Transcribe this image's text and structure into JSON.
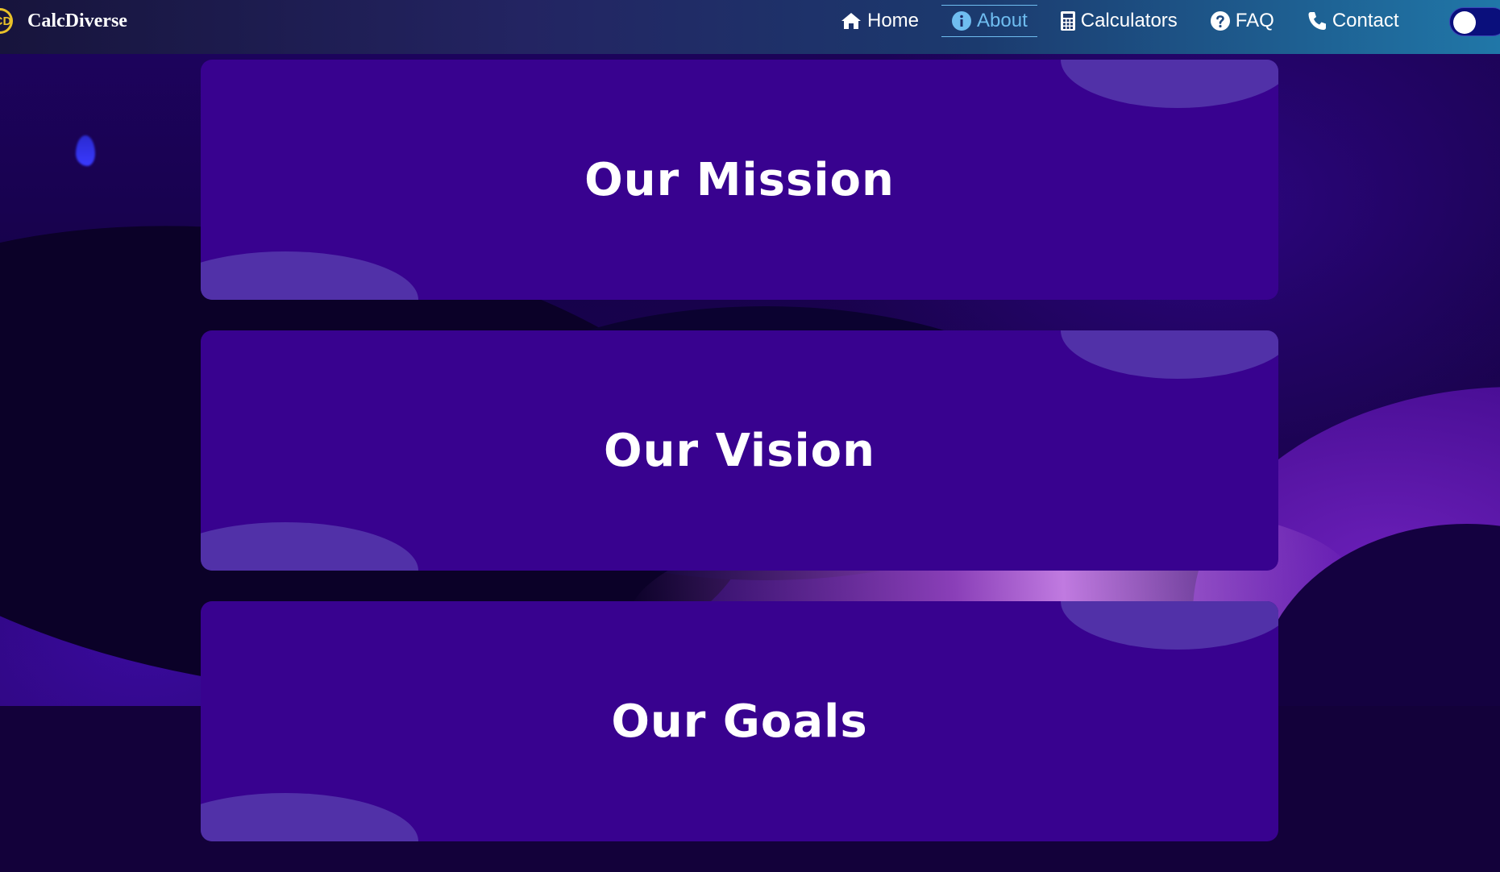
{
  "brand": {
    "logo_text": "CD",
    "name": "CalcDiverse"
  },
  "nav": {
    "items": [
      {
        "label": "Home",
        "icon": "home-icon"
      },
      {
        "label": "About",
        "icon": "info-icon",
        "active": true
      },
      {
        "label": "Calculators",
        "icon": "calculator-icon"
      },
      {
        "label": "FAQ",
        "icon": "question-icon"
      },
      {
        "label": "Contact",
        "icon": "phone-icon"
      }
    ],
    "theme_toggle": "toggle-icon",
    "active_color": "#6fbdf0"
  },
  "sections": [
    {
      "title": "Our Mission"
    },
    {
      "title": "Our Vision"
    },
    {
      "title": "Our Goals"
    }
  ],
  "colors": {
    "card": "#38028f",
    "card_accent": "#5131a8",
    "logo": "#e9c129"
  }
}
